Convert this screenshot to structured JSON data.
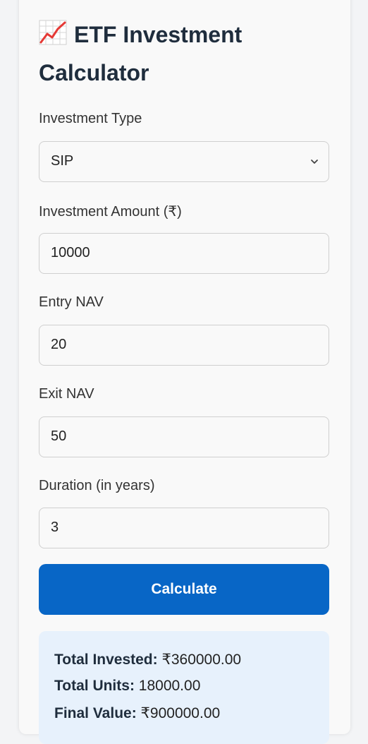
{
  "header": {
    "icon": "chart-increasing-icon",
    "title": "ETF Investment Calculator"
  },
  "form": {
    "investment_type": {
      "label": "Investment Type",
      "value": "SIP"
    },
    "investment_amount": {
      "label": "Investment Amount (₹)",
      "value": "10000"
    },
    "entry_nav": {
      "label": "Entry NAV",
      "value": "20"
    },
    "exit_nav": {
      "label": "Exit NAV",
      "value": "50"
    },
    "duration": {
      "label": "Duration (in years)",
      "value": "3"
    }
  },
  "actions": {
    "calculate_label": "Calculate"
  },
  "results": {
    "total_invested_label": "Total Invested:",
    "total_invested_value": "₹360000.00",
    "total_units_label": "Total Units:",
    "total_units_value": "18000.00",
    "final_value_label": "Final Value:",
    "final_value_value": "₹900000.00"
  },
  "colors": {
    "accent": "#0866c6",
    "result_bg": "#e7f1fc",
    "title": "#1f2d3d"
  }
}
